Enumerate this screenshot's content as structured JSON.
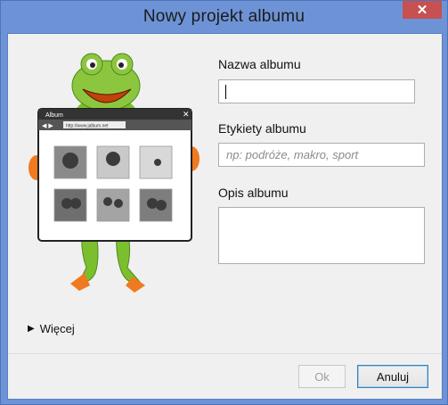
{
  "window": {
    "title": "Nowy projekt albumu"
  },
  "form": {
    "name_label": "Nazwa albumu",
    "name_value": "",
    "tags_label": "Etykiety albumu",
    "tags_placeholder": "np: podróże, makro, sport",
    "desc_label": "Opis albumu",
    "desc_value": ""
  },
  "illustration": {
    "window_title": "Album",
    "url": "http://www.jalbum.net"
  },
  "more_label": "Więcej",
  "buttons": {
    "ok": "Ok",
    "cancel": "Anuluj"
  },
  "colors": {
    "frame": "#6d93d6",
    "close": "#c75050",
    "frog": "#8cc63f"
  }
}
